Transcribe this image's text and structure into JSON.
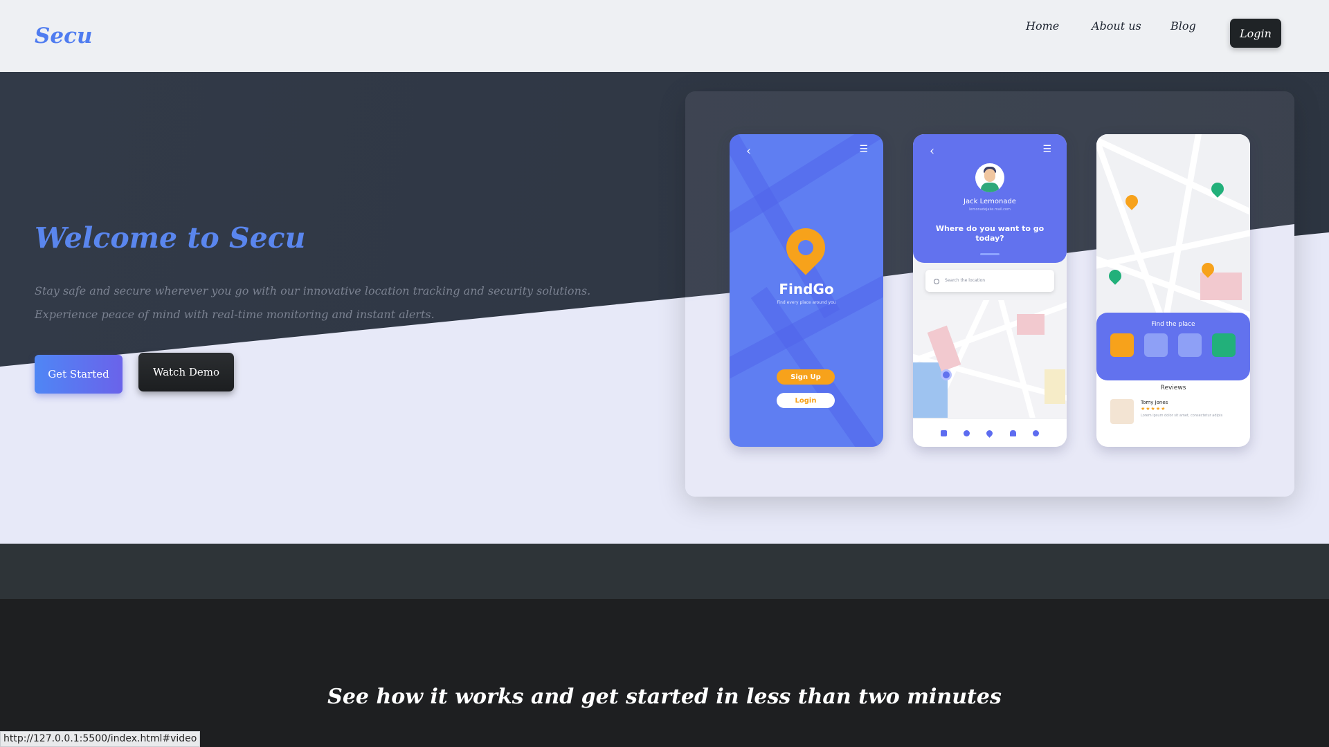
{
  "nav": {
    "logo": "Secu",
    "links": [
      "Home",
      "About us",
      "Blog"
    ],
    "login": "Login"
  },
  "hero": {
    "title": "Welcome to Secu",
    "description": "Stay safe and secure wherever you go with our innovative location tracking and security solutions. Experience peace of mind with real-time monitoring and instant alerts.",
    "get_started": "Get Started",
    "watch_demo": "Watch Demo"
  },
  "mockup": {
    "phone1": {
      "app_name": "FindGo",
      "tagline": "Find every place around you",
      "signup": "Sign Up",
      "login": "Login"
    },
    "phone2": {
      "user_name": "Jack Lemonade",
      "user_email": "lemonadejake.mail.com",
      "question": "Where do you want to go today?",
      "search_placeholder": "Search the location"
    },
    "phone3": {
      "find_title": "Find the place",
      "reviews_title": "Reviews",
      "reviewer": "Tomy Jones",
      "review_text": "Lorem ipsum dolor sit amet, consectetur adipis",
      "stars": "★★★★★"
    }
  },
  "tagline": "See how it works and get started in less than two minutes",
  "status_url": "http://127.0.0.1:5500/index.html#video",
  "colors": {
    "accent": "#5a86ee",
    "primary_purple": "#6272ee",
    "orange": "#f7a21b",
    "green": "#22b07a"
  }
}
